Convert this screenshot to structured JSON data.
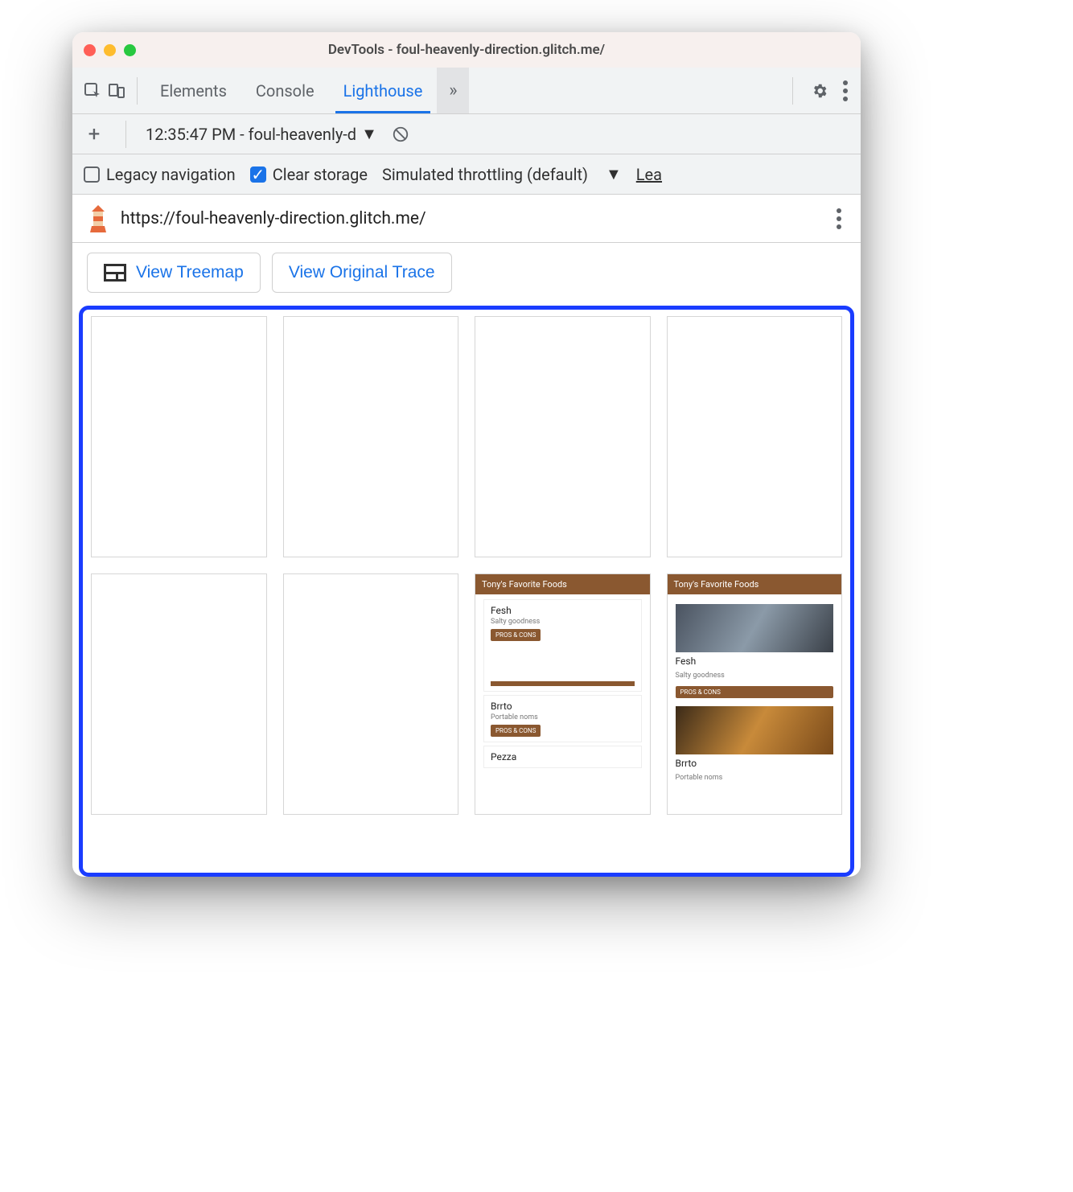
{
  "window": {
    "title": "DevTools - foul-heavenly-direction.glitch.me/"
  },
  "toolbar": {
    "tabs": {
      "elements": "Elements",
      "console": "Console",
      "lighthouse": "Lighthouse"
    }
  },
  "subbar": {
    "report_label": "12:35:47 PM - foul-heavenly-d"
  },
  "options": {
    "legacy": "Legacy navigation",
    "clear": "Clear storage",
    "throttling": "Simulated throttling (default)",
    "learn": "Lea"
  },
  "urlbar": {
    "url": "https://foul-heavenly-direction.glitch.me/"
  },
  "buttons": {
    "treemap": "View Treemap",
    "trace": "View Original Trace"
  },
  "filmstrip": {
    "header": "Tony's Favorite Foods",
    "items": [
      {
        "title": "Fesh",
        "sub": "Salty goodness",
        "btn": "PROS & CONS"
      },
      {
        "title": "Brrto",
        "sub": "Portable noms",
        "btn": "PROS & CONS"
      },
      {
        "title": "Pezza",
        "sub": ""
      }
    ]
  }
}
